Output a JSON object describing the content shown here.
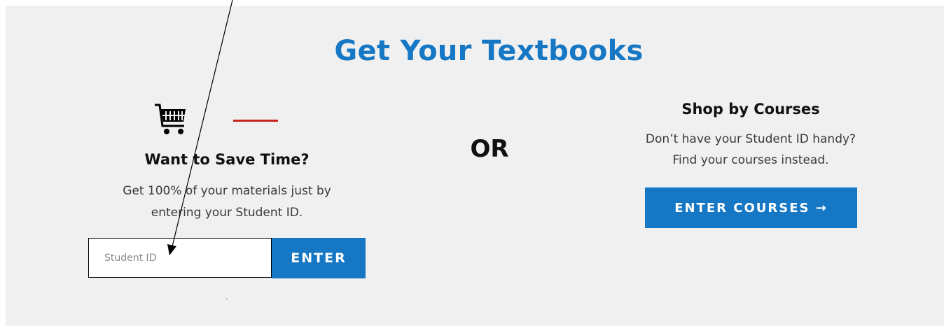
{
  "header": {
    "title": "Get Your Textbooks"
  },
  "student_id_section": {
    "heading": "Want to Save Time?",
    "description_line1": "Get 100% of your materials just by",
    "description_line2": "entering your Student ID.",
    "input_placeholder": "Student ID",
    "enter_label": "ENTER",
    "footnote": "."
  },
  "divider": {
    "or_label": "OR"
  },
  "courses_section": {
    "heading": "Shop by Courses",
    "description_line1": "Don’t have your Student ID handy?",
    "description_line2": "Find your courses instead.",
    "button_label": "ENTER COURSES →"
  },
  "colors": {
    "accent": "#1677c4",
    "red_rule": "#c8231f",
    "panel_bg": "#f0f0f0"
  },
  "icons": {
    "cart": "shopping-cart-icon"
  }
}
